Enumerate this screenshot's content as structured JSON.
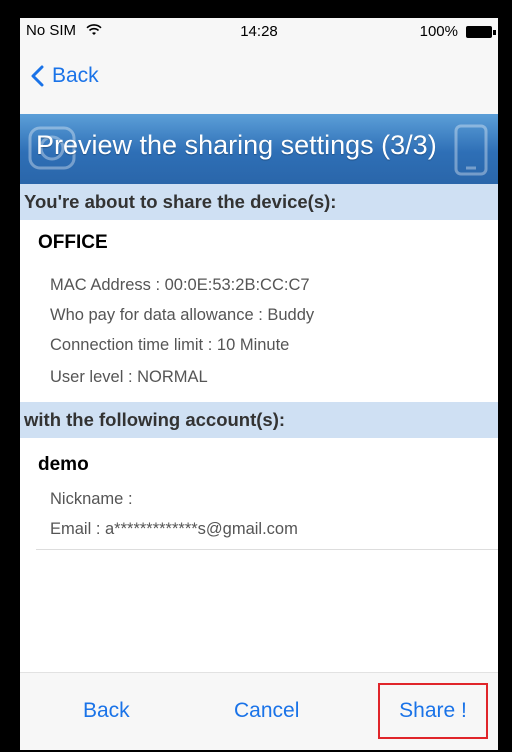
{
  "status_bar": {
    "carrier": "No SIM",
    "time": "14:28",
    "battery": "100%"
  },
  "nav": {
    "back_label": "Back"
  },
  "banner": {
    "title": "Preview the sharing settings (3/3)"
  },
  "device_section": {
    "header": "You're about to share the device(s):",
    "device_name": "OFFICE",
    "details": [
      "MAC Address : 00:0E:53:2B:CC:C7",
      "Who pay for data allowance : Buddy",
      "Connection time limit : 10 Minute",
      "User level : NORMAL"
    ]
  },
  "account_section": {
    "header": "with the following account(s):",
    "account_name": "demo",
    "details": [
      "Nickname :",
      "Email : a*************s@gmail.com"
    ]
  },
  "toolbar": {
    "back_label": "Back",
    "cancel_label": "Cancel",
    "share_label": "Share !"
  },
  "colors": {
    "accent": "#1a73e8",
    "banner": "#3a7cc0",
    "section_header": "#cfe0f3",
    "highlight_border": "#e0252a"
  }
}
